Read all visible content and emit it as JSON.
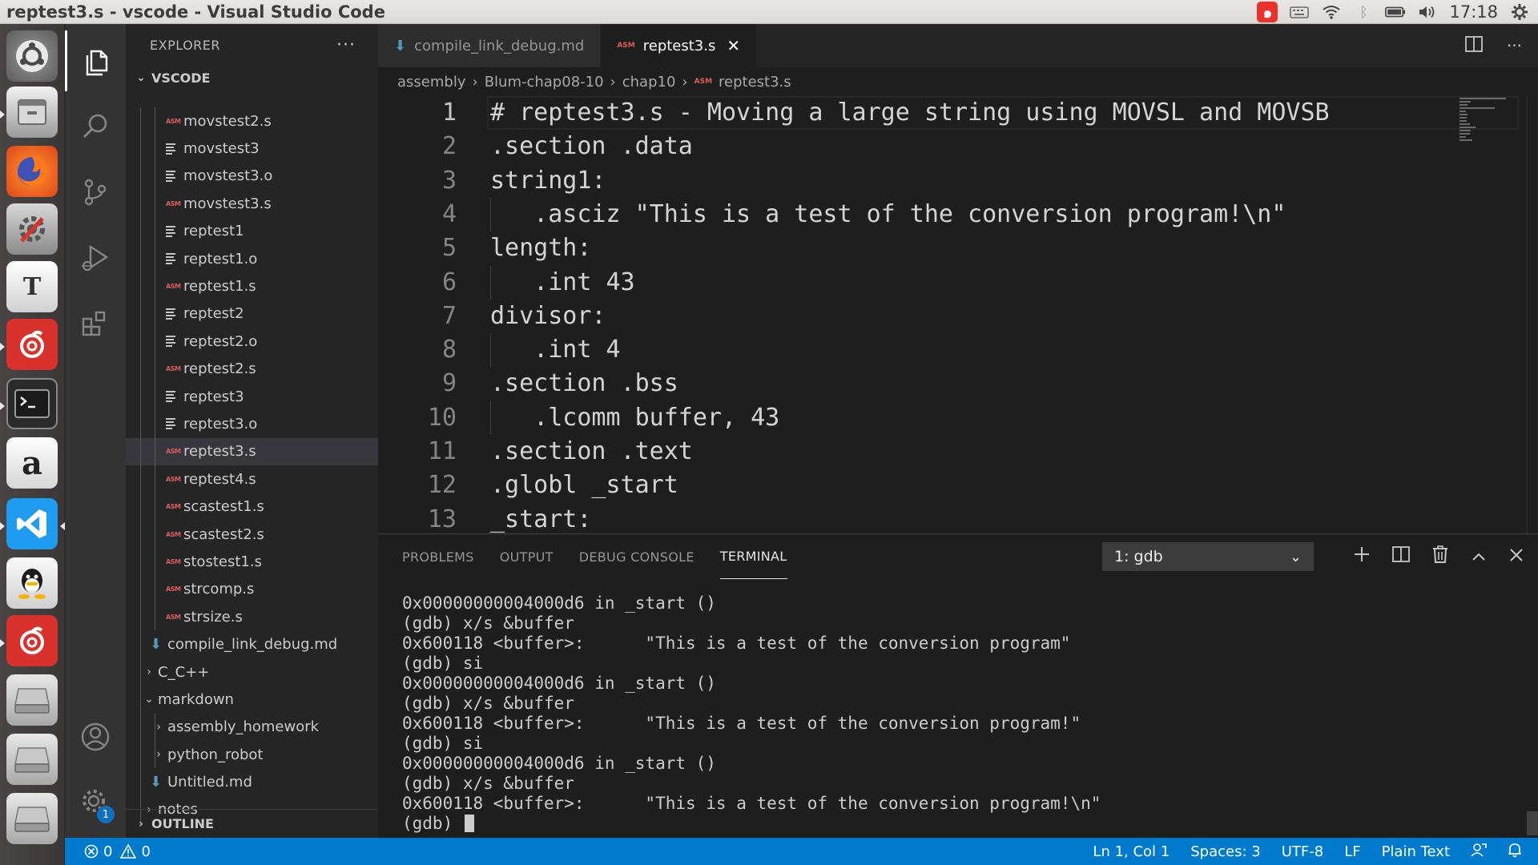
{
  "window": {
    "title": "reptest3.s - vscode - Visual Studio Code"
  },
  "tray": {
    "clock": "17:18"
  },
  "launcher": {
    "apps": [
      "ubuntu-dash",
      "files",
      "firefox",
      "system-settings",
      "text-editor",
      "netease-music",
      "terminal",
      "amazon",
      "vscode",
      "qq",
      "netease-music",
      "disk",
      "disk",
      "disk"
    ]
  },
  "explorer": {
    "title": "EXPLORER",
    "more": "···",
    "section": "VSCODE",
    "files": [
      {
        "name": "movstest2.s",
        "type": "asm"
      },
      {
        "name": "movstest3",
        "type": "txt"
      },
      {
        "name": "movstest3.o",
        "type": "txt"
      },
      {
        "name": "movstest3.s",
        "type": "asm"
      },
      {
        "name": "reptest1",
        "type": "txt"
      },
      {
        "name": "reptest1.o",
        "type": "txt"
      },
      {
        "name": "reptest1.s",
        "type": "asm"
      },
      {
        "name": "reptest2",
        "type": "txt"
      },
      {
        "name": "reptest2.o",
        "type": "txt"
      },
      {
        "name": "reptest2.s",
        "type": "asm"
      },
      {
        "name": "reptest3",
        "type": "txt"
      },
      {
        "name": "reptest3.o",
        "type": "txt"
      },
      {
        "name": "reptest3.s",
        "type": "asm",
        "selected": true
      },
      {
        "name": "reptest4.s",
        "type": "asm"
      },
      {
        "name": "scastest1.s",
        "type": "asm"
      },
      {
        "name": "scastest2.s",
        "type": "asm"
      },
      {
        "name": "stostest1.s",
        "type": "asm"
      },
      {
        "name": "strcomp.s",
        "type": "asm"
      },
      {
        "name": "strsize.s",
        "type": "asm"
      }
    ],
    "other": [
      {
        "name": "compile_link_debug.md",
        "type": "md",
        "depth": 1
      },
      {
        "name": "C_C++",
        "type": "folder-closed",
        "depth": 0
      },
      {
        "name": "markdown",
        "type": "folder-open",
        "depth": 0
      },
      {
        "name": "assembly_homework",
        "type": "folder-closed",
        "depth": 1
      },
      {
        "name": "python_robot",
        "type": "folder-closed",
        "depth": 1
      },
      {
        "name": "Untitled.md",
        "type": "md",
        "depth": 1
      },
      {
        "name": "notes",
        "type": "folder-closed",
        "depth": 0
      }
    ],
    "outline": "OUTLINE"
  },
  "tabs": [
    {
      "label": "compile_link_debug.md",
      "type": "md",
      "active": false
    },
    {
      "label": "reptest3.s",
      "type": "asm",
      "active": true
    }
  ],
  "file_icon_label": "ASM",
  "breadcrumb": [
    "assembly",
    "Blum-chap08-10",
    "chap10",
    "reptest3.s"
  ],
  "editor": {
    "current_line": 1,
    "lines": [
      {
        "n": "1",
        "text": "# reptest3.s - Moving a large string using MOVSL and MOVSB",
        "indent": false
      },
      {
        "n": "2",
        "text": ".section .data",
        "indent": false
      },
      {
        "n": "3",
        "text": "string1:",
        "indent": false
      },
      {
        "n": "4",
        "text": "   .asciz \"This is a test of the conversion program!\\n\"",
        "indent": true
      },
      {
        "n": "5",
        "text": "length:",
        "indent": false
      },
      {
        "n": "6",
        "text": "   .int 43",
        "indent": true
      },
      {
        "n": "7",
        "text": "divisor:",
        "indent": false
      },
      {
        "n": "8",
        "text": "   .int 4",
        "indent": true
      },
      {
        "n": "9",
        "text": ".section .bss",
        "indent": false
      },
      {
        "n": "10",
        "text": "   .lcomm buffer, 43",
        "indent": true
      },
      {
        "n": "11",
        "text": ".section .text",
        "indent": false
      },
      {
        "n": "12",
        "text": ".globl _start",
        "indent": false
      },
      {
        "n": "13",
        "text": "_start:",
        "indent": false
      }
    ]
  },
  "panel": {
    "tabs": [
      "PROBLEMS",
      "OUTPUT",
      "DEBUG CONSOLE",
      "TERMINAL"
    ],
    "active_tab": "TERMINAL",
    "terminal_select": "1: gdb",
    "terminal_lines": [
      "0x00000000004000d6 in _start ()",
      "(gdb) x/s &buffer",
      "0x600118 <buffer>:      \"This is a test of the conversion program\"",
      "(gdb) si",
      "0x00000000004000d6 in _start ()",
      "(gdb) x/s &buffer",
      "0x600118 <buffer>:      \"This is a test of the conversion program!\"",
      "(gdb) si",
      "0x00000000004000d6 in _start ()",
      "(gdb) x/s &buffer",
      "0x600118 <buffer>:      \"This is a test of the conversion program!\\n\""
    ],
    "prompt": "(gdb) "
  },
  "status": {
    "errors": "0",
    "warnings": "0",
    "position": "Ln 1, Col 1",
    "spaces": "Spaces: 3",
    "encoding": "UTF-8",
    "eol": "LF",
    "language": "Plain Text"
  },
  "activity": {
    "settings_badge": "1"
  },
  "colors": {
    "accent": "#007acc",
    "asm_icon": "#e05a5a",
    "md_icon": "#519aba"
  }
}
